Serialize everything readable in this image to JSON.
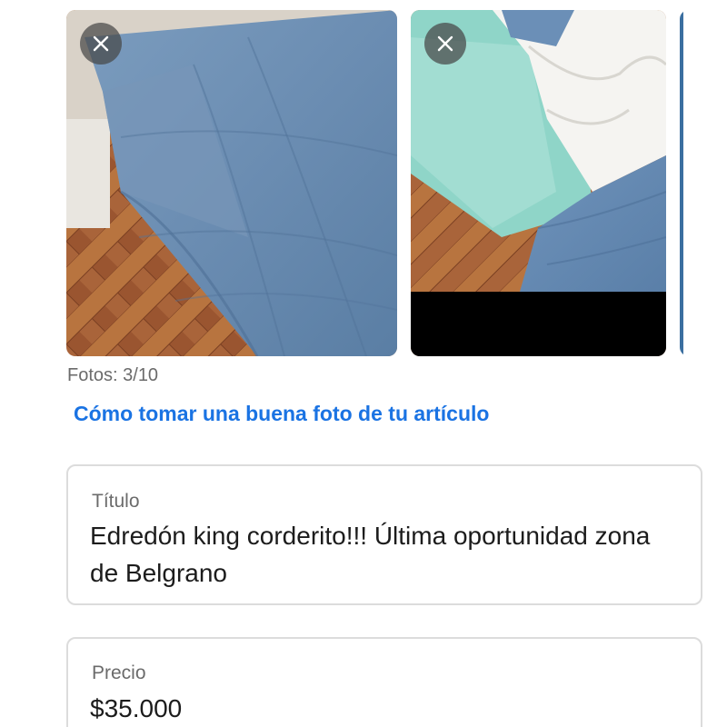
{
  "photos": {
    "count_label": "Fotos: 3/10",
    "tips_link": "Cómo tomar una buena foto de tu artículo",
    "items": [
      {
        "description": "blue comforter on bed over parquet floor",
        "remove_icon": "close-icon"
      },
      {
        "description": "blue comforter with white sherpa lining on mint sheet",
        "remove_icon": "close-icon"
      },
      {
        "description": "partially visible photo"
      }
    ]
  },
  "form": {
    "title": {
      "label": "Título",
      "value": "Edredón king corderito!!! Última oportunidad zona de Belgrano"
    },
    "price": {
      "label": "Precio",
      "value": "$35.000"
    }
  },
  "colors": {
    "link": "#1a73e3",
    "label": "#6b6b6b",
    "border": "#dcdcdc",
    "text": "#1c1c1c"
  }
}
